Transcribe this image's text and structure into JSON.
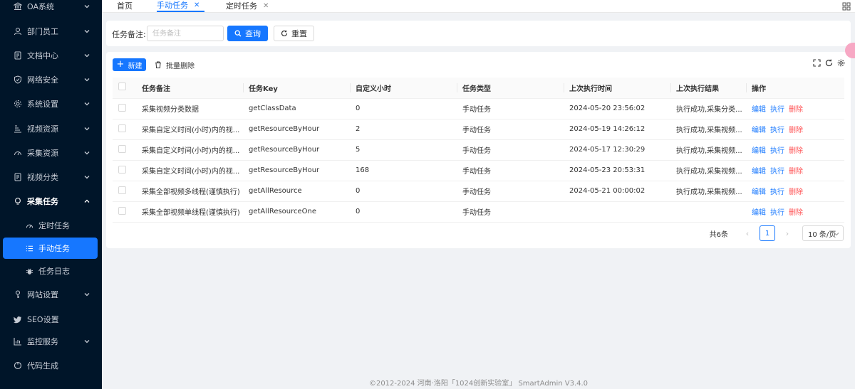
{
  "sidebar": {
    "items": [
      {
        "label": "OA系统",
        "icon": "bank-icon",
        "has_children": true
      },
      {
        "label": "部门员工",
        "icon": "user-icon",
        "has_children": true
      },
      {
        "label": "文档中心",
        "icon": "file-icon",
        "has_children": true
      },
      {
        "label": "网络安全",
        "icon": "shield-icon",
        "has_children": true
      },
      {
        "label": "系统设置",
        "icon": "gear-icon",
        "has_children": true
      },
      {
        "label": "视频资源",
        "icon": "list-icon",
        "has_children": true
      },
      {
        "label": "采集资源",
        "icon": "dashboard-icon",
        "has_children": true
      },
      {
        "label": "视频分类",
        "icon": "file-icon",
        "has_children": true
      },
      {
        "label": "采集任务",
        "icon": "bulb-icon",
        "has_children": true,
        "open": true
      }
    ],
    "sub_items": [
      {
        "label": "定时任务",
        "icon": "dashboard-icon"
      },
      {
        "label": "手动任务",
        "icon": "menu-icon",
        "active": true
      },
      {
        "label": "任务日志",
        "icon": "bug-icon"
      }
    ],
    "bottom_items": [
      {
        "label": "网站设置",
        "icon": "key-icon",
        "has_children": true
      },
      {
        "label": "SEO设置",
        "icon": "twitter-icon",
        "has_children": false
      },
      {
        "label": "监控服务",
        "icon": "chart-icon",
        "has_children": true
      },
      {
        "label": "代码生成",
        "icon": "code-icon",
        "has_children": false
      }
    ]
  },
  "tabs": [
    {
      "label": "首页",
      "closable": false
    },
    {
      "label": "手动任务",
      "closable": true,
      "active": true
    },
    {
      "label": "定时任务",
      "closable": true
    }
  ],
  "search": {
    "label": "任务备注:",
    "placeholder": "任务备注",
    "query_label": "查询",
    "reset_label": "重置"
  },
  "toolbar": {
    "new_label": "新建",
    "batch_delete_label": "批量删除"
  },
  "table": {
    "columns": [
      "任务备注",
      "任务Key",
      "自定义小时",
      "任务类型",
      "上次执行时间",
      "上次执行结果",
      "操作"
    ],
    "rows": [
      {
        "remark": "采集视频分类数据",
        "key": "getClassData",
        "hours": "0",
        "type": "手动任务",
        "last_time": "2024-05-20 23:56:02",
        "last_result": "执行成功,采集分类..."
      },
      {
        "remark": "采集自定义时间(小时)内的视...",
        "key": "getResourceByHour",
        "hours": "2",
        "type": "手动任务",
        "last_time": "2024-05-19 14:26:12",
        "last_result": "执行成功,采集视频..."
      },
      {
        "remark": "采集自定义时间(小时)内的视...",
        "key": "getResourceByHour",
        "hours": "5",
        "type": "手动任务",
        "last_time": "2024-05-17 12:30:29",
        "last_result": "执行成功,采集视频..."
      },
      {
        "remark": "采集自定义时间(小时)内的视...",
        "key": "getResourceByHour",
        "hours": "168",
        "type": "手动任务",
        "last_time": "2024-05-23 20:53:31",
        "last_result": "执行成功,采集视频..."
      },
      {
        "remark": "采集全部视频多线程(谨慎执行)",
        "key": "getAllResource",
        "hours": "0",
        "type": "手动任务",
        "last_time": "2024-05-21 00:00:02",
        "last_result": "执行成功,采集视频..."
      },
      {
        "remark": "采集全部视频单线程(谨慎执行)",
        "key": "getAllResourceOne",
        "hours": "0",
        "type": "手动任务",
        "last_time": "",
        "last_result": ""
      }
    ],
    "actions": {
      "edit": "编辑",
      "run": "执行",
      "delete": "删除"
    }
  },
  "pagination": {
    "total_text": "共6条",
    "current_page": "1",
    "page_size": "10 条/页"
  },
  "footer": {
    "copyright": "©2012-2024 河南·洛阳「1024创新实验室」 SmartAdmin V3.4.0"
  },
  "colors": {
    "sidebar_bg": "#001529",
    "primary": "#1677ff",
    "danger": "#ff4d4f",
    "page_bg": "#f0f2f5"
  }
}
